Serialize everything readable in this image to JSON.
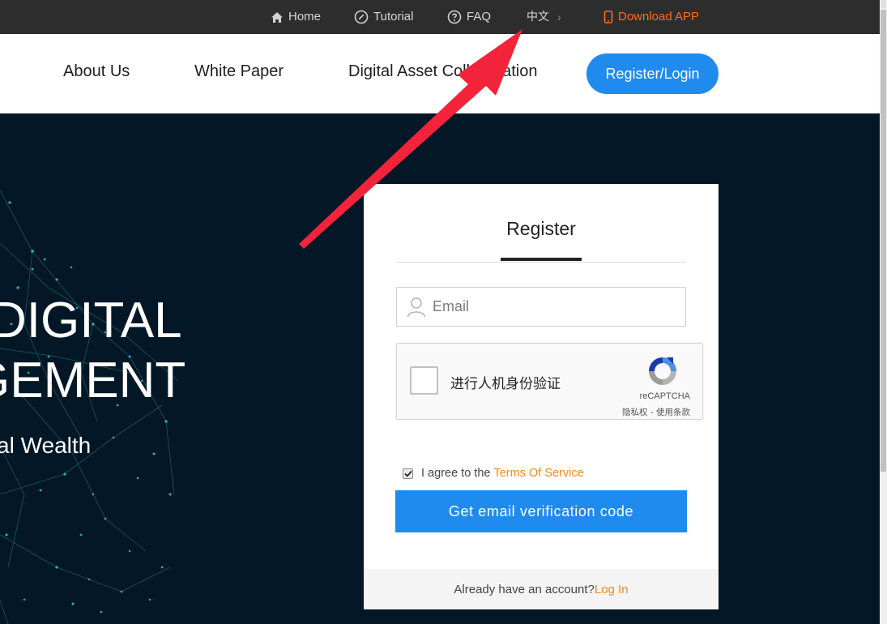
{
  "topbar": {
    "home": "Home",
    "tutorial": "Tutorial",
    "faq": "FAQ",
    "language": "中文",
    "download_app": "Download APP"
  },
  "nav": {
    "about": "About Us",
    "white_paper": "White Paper",
    "digital_asset": "Digital Asset Collaboration",
    "register_login": "Register/Login"
  },
  "hero": {
    "line1": "DIGITAL",
    "line2": "GEMENT",
    "subtitle": "al Wealth"
  },
  "register": {
    "title": "Register",
    "email_placeholder": "Email",
    "recaptcha_label": "进行人机身份验证",
    "recaptcha_brand": "reCAPTCHA",
    "recaptcha_links": "隐私权 - 使用条款",
    "agree_text": "I agree to the",
    "terms_link": "Terms Of Service",
    "verify_button": "Get email verification code",
    "footer_text": "Already have an account?",
    "login_link": "Log In"
  },
  "colors": {
    "topbar_bg": "#2d2d2d",
    "accent_blue": "#1f8bef",
    "accent_orange": "#f08a24",
    "download_orange": "#ff6a1a",
    "hero_bg": "#041726",
    "annotation_arrow": "#f2233b"
  },
  "icons": {
    "home": "home-icon",
    "tutorial": "compass-icon",
    "faq": "question-circle-icon",
    "language": "chevron-right-icon",
    "download": "mobile-phone-icon",
    "email": "user-icon",
    "recaptcha": "recaptcha-logo-icon"
  }
}
